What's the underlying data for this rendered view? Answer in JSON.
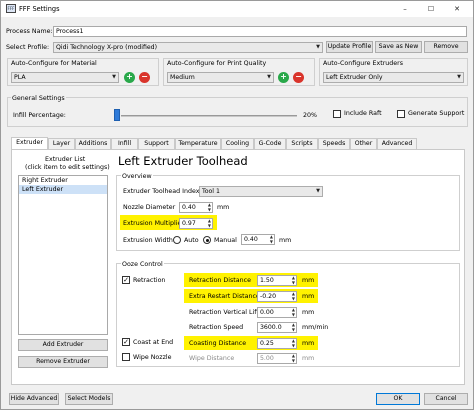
{
  "window": {
    "title": "FFF Settings",
    "app_icon": "FFF"
  },
  "controls": {
    "minimize": "–",
    "maximize": "☐",
    "close": "✕"
  },
  "process": {
    "label": "Process Name:",
    "value": "Process1"
  },
  "profile": {
    "label": "Select Profile:",
    "value": "Qidi Technology X-pro (modified)",
    "update_label": "Update Profile",
    "save_new_label": "Save as New",
    "remove_label": "Remove"
  },
  "material": {
    "label": "Auto-Configure for Material",
    "value": "PLA"
  },
  "quality": {
    "label": "Auto-Configure for Print Quality",
    "value": "Medium"
  },
  "extruders_auto": {
    "label": "Auto-Configure Extruders",
    "value": "Left Extruder Only"
  },
  "general": {
    "label": "General Settings",
    "infill_label": "Infill Percentage:",
    "infill_value": "20%",
    "infill_fraction": 0.2,
    "raft_label": "Include Raft",
    "support_label": "Generate Support"
  },
  "tabs": [
    "Extruder",
    "Layer",
    "Additions",
    "Infill",
    "Support",
    "Temperature",
    "Cooling",
    "G-Code",
    "Scripts",
    "Speeds",
    "Other",
    "Advanced"
  ],
  "extruder_list": {
    "title_line1": "Extruder List",
    "title_line2": "(click item to edit settings)",
    "items": [
      "Right Extruder",
      "Left Extruder"
    ],
    "add_label": "Add Extruder",
    "remove_label": "Remove Extruder"
  },
  "toolhead": {
    "heading": "Left Extruder Toolhead",
    "overview_label": "Overview",
    "index_label": "Extruder Toolhead Index",
    "index_value": "Tool 1",
    "nozzle_label": "Nozzle Diameter",
    "nozzle_value": "0.40",
    "nozzle_unit": "mm",
    "mult_label": "Extrusion Multiplier",
    "mult_value": "0.97",
    "width_label": "Extrusion Width",
    "width_auto": "Auto",
    "width_manual": "Manual",
    "width_value": "0.40",
    "width_unit": "mm"
  },
  "ooze": {
    "label": "Ooze Control",
    "retraction_label": "Retraction",
    "retraction_distance_label": "Retraction Distance",
    "retraction_distance_value": "1.50",
    "retraction_distance_unit": "mm",
    "extra_restart_label": "Extra Restart Distance",
    "extra_restart_value": "-0.20",
    "extra_restart_unit": "mm",
    "vertical_lift_label": "Retraction Vertical Lift",
    "vertical_lift_value": "0.00",
    "vertical_lift_unit": "mm",
    "speed_label": "Retraction Speed",
    "speed_value": "3600.0",
    "speed_unit": "mm/min",
    "coast_label": "Coast at End",
    "coast_distance_label": "Coasting Distance",
    "coast_distance_value": "0.25",
    "coast_distance_unit": "mm",
    "wipe_label": "Wipe Nozzle",
    "wipe_distance_label": "Wipe Distance",
    "wipe_distance_value": "5.00",
    "wipe_distance_unit": "mm"
  },
  "footer": {
    "hide_advanced": "Hide Advanced",
    "select_models": "Select Models",
    "ok": "OK",
    "cancel": "Cancel"
  },
  "colors": {
    "highlight": "#fff200",
    "accent": "#2f7bd9",
    "add": "#29a84a",
    "remove": "#d9342b"
  }
}
